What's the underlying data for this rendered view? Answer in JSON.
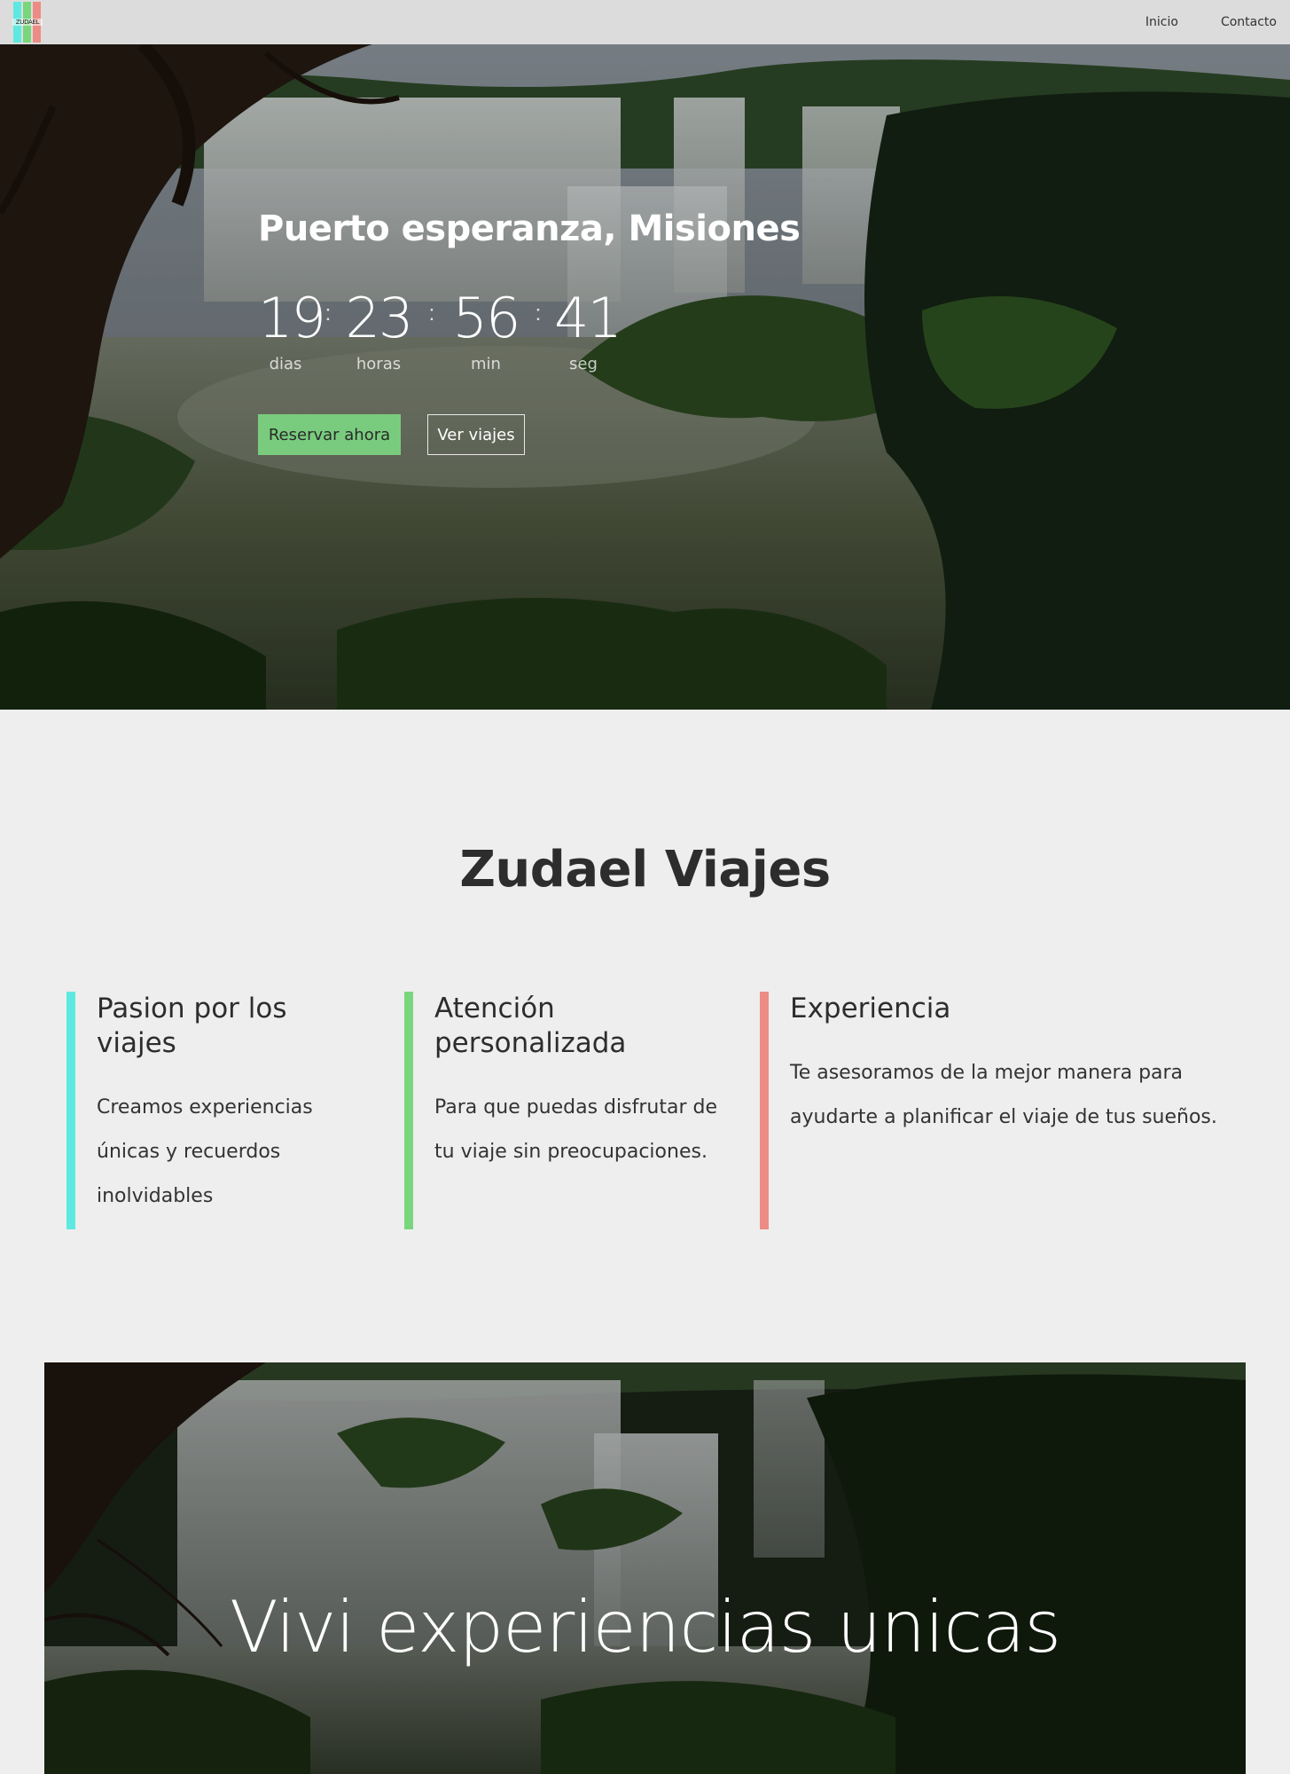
{
  "nav": {
    "logo_text": "ZUDAEL",
    "links": [
      "Inicio",
      "Contacto"
    ]
  },
  "hero": {
    "title": "Puerto esperanza, Misiones",
    "countdown": [
      {
        "value": "19",
        "label": "dias"
      },
      {
        "value": "23",
        "label": "horas"
      },
      {
        "value": "56",
        "label": "min"
      },
      {
        "value": "41",
        "label": "seg"
      }
    ],
    "separator": ":",
    "primary_button": "Reservar ahora",
    "secondary_button": "Ver viajes"
  },
  "about": {
    "title": "Zudael Viajes",
    "features": [
      {
        "title": "Pasion por los viajes",
        "text": "Creamos experiencias únicas y recuerdos inolvidables",
        "accent_color": "#5ee9e0"
      },
      {
        "title": "Atención personalizada",
        "text": "Para que puedas disfrutar de tu viaje sin preocupaciones.",
        "accent_color": "#79d67c"
      },
      {
        "title": "Experiencia",
        "text": "Te asesoramos de la mejor manera para ayudarte a planificar el viaje de tus sueños.",
        "accent_color": "#ec8c84"
      }
    ]
  },
  "banner": {
    "text": "Vivi experiencias unicas"
  },
  "colors": {
    "nav_bg": "#dcdcdc",
    "page_bg": "#eeeeee",
    "primary_button": "#79cc7e"
  }
}
